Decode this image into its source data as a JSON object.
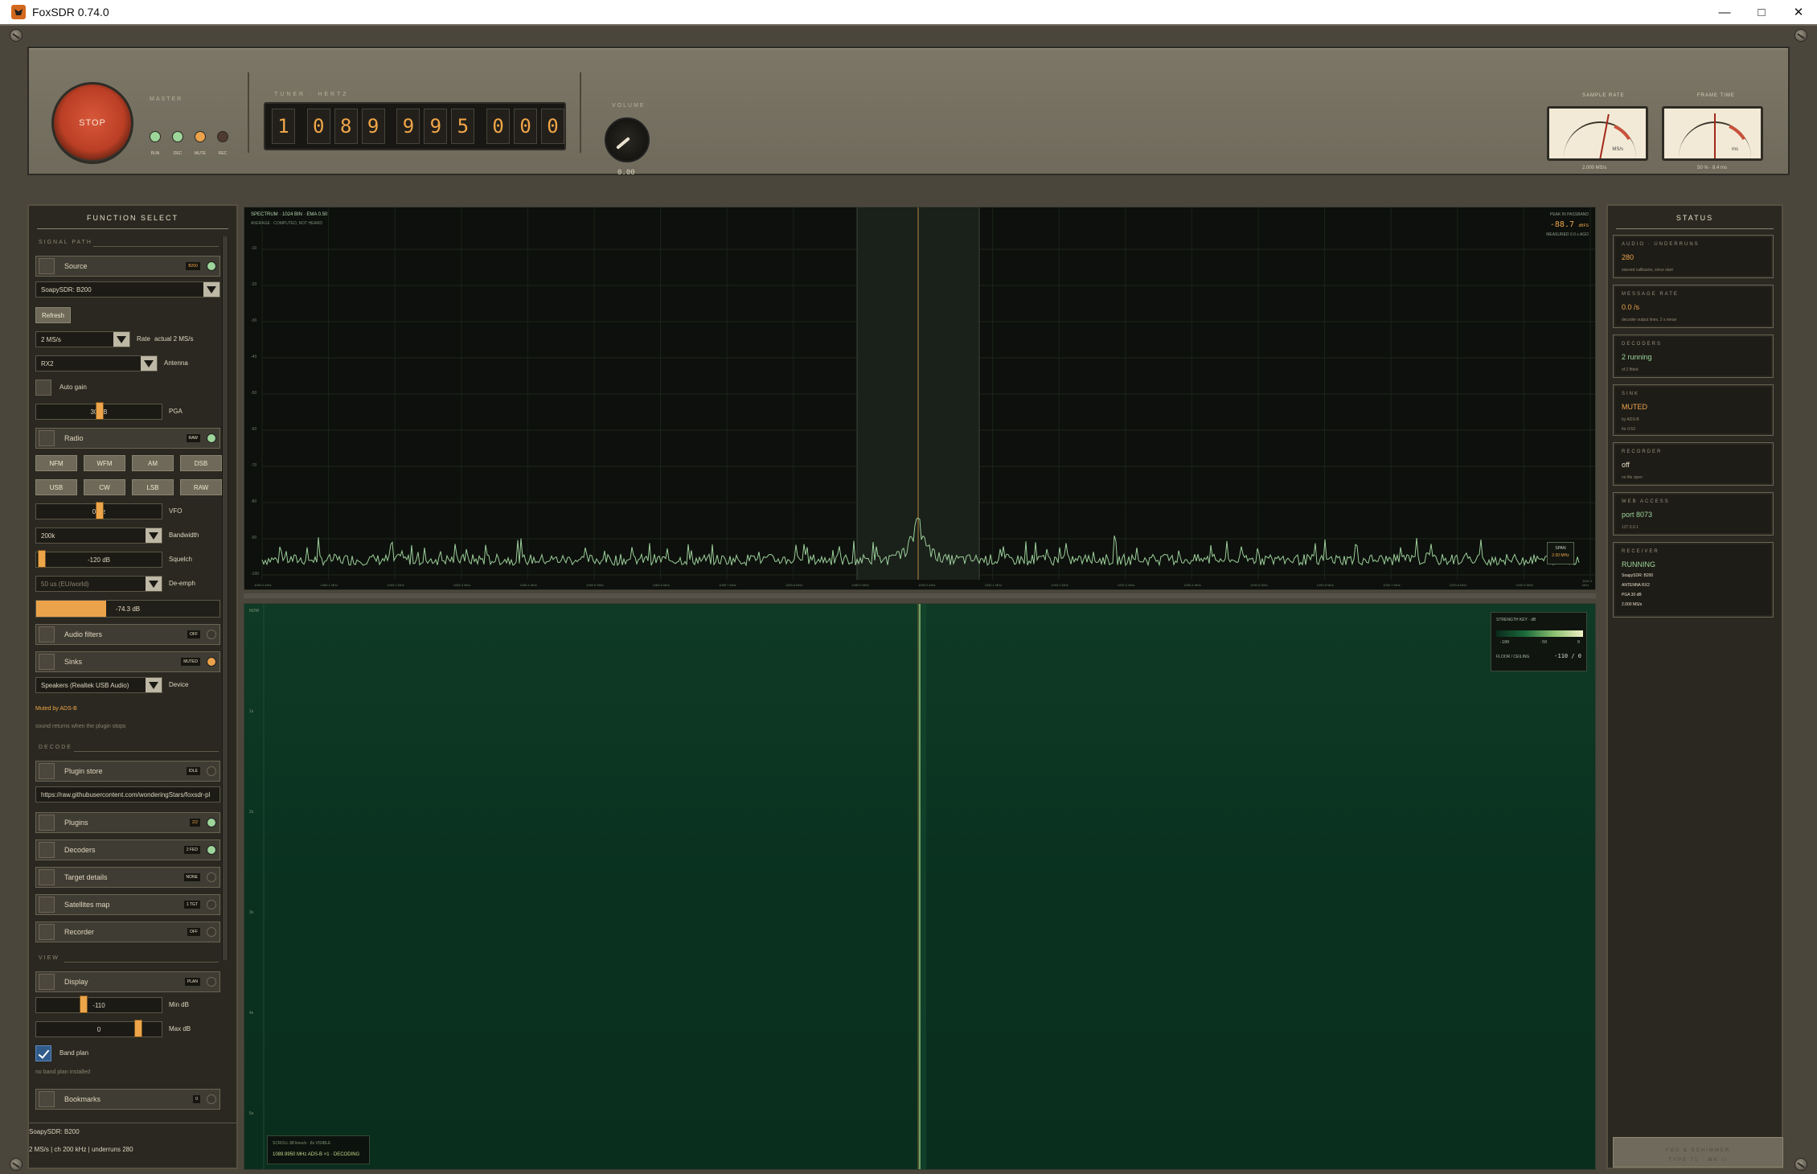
{
  "window": {
    "title": "FoxSDR 0.74.0"
  },
  "master": {
    "stop_label": "STOP",
    "section_label": "MASTER",
    "leds": [
      {
        "label": "RUN",
        "color": "#9dd59a"
      },
      {
        "label": "DEC",
        "color": "#9dd59a"
      },
      {
        "label": "MUTE",
        "color": "#eba24a"
      },
      {
        "label": "REC",
        "color": "#4e3a2f"
      }
    ]
  },
  "tuner": {
    "label": "TUNER · HERTZ",
    "digits": [
      "1",
      "0",
      "8",
      "9",
      "9",
      "9",
      "5",
      "0",
      "0",
      "0"
    ]
  },
  "knob": {
    "label": "VOLUME",
    "value": "0.00"
  },
  "meters": [
    {
      "label": "SAMPLE RATE",
      "unit": "MS/s",
      "value": "2.000 MS/s",
      "level": 0.62
    },
    {
      "label": "FRAME TIME",
      "unit": "ms",
      "value": "50 % · 8.4 ms",
      "level": 0.5
    }
  ],
  "function_select": {
    "title": "FUNCTION SELECT",
    "sections": {
      "signal": "SIGNAL PATH",
      "decode": "DECODE",
      "view": "VIEW"
    },
    "source": {
      "label": "Source",
      "badge": "B200",
      "device": "SoapySDR: B200",
      "refresh": "Refresh",
      "rate": "2 MS/s",
      "rate_label": "Rate",
      "rate_actual": "actual 2 MS/s",
      "antenna": "RX2",
      "antenna_label": "Antenna",
      "autogain": "Auto gain",
      "pga_value": "30 dB",
      "pga_label": "PGA"
    },
    "radio": {
      "label": "Radio",
      "badge": "RAW",
      "modes": [
        "NFM",
        "WFM",
        "AM",
        "DSB",
        "USB",
        "CW",
        "LSB",
        "RAW"
      ],
      "vfo_value": "0 Hz",
      "vfo_label": "VFO",
      "bandwidth": "200k",
      "bandwidth_label": "Bandwidth",
      "squelch_value": "-120 dB",
      "squelch_label": "Squelch",
      "deemph": "50 us (EU/world)",
      "deemph_label": "De-emph",
      "level_value": "-74.3 dB",
      "level_fraction": 0.38
    },
    "audio_filters": {
      "label": "Audio filters",
      "badge": "OFF"
    },
    "sinks": {
      "label": "Sinks",
      "badge": "MUTED",
      "device": "Speakers (Realtek USB Audio)",
      "device_label": "Device",
      "muted_by": "Muted by ADS-B",
      "note": "sound returns when the plugin stops"
    },
    "plugin_store": {
      "label": "Plugin store",
      "badge": "IDLE",
      "url": "https://raw.githubusercontent.com/wonderingStars/foxsdr-pl"
    },
    "plugins": {
      "label": "Plugins",
      "badge": "2/2"
    },
    "decoders": {
      "label": "Decoders",
      "badge": "2 FED"
    },
    "target_details": {
      "label": "Target details",
      "badge": "NONE"
    },
    "satellites_map": {
      "label": "Satellites map",
      "badge": "1 TGT"
    },
    "recorder": {
      "label": "Recorder",
      "badge": "OFF"
    },
    "display": {
      "label": "Display",
      "badge": "PLAN",
      "min_value": "-110",
      "min_label": "Min dB",
      "max_value": "0",
      "max_label": "Max dB",
      "bandplan": "Band plan",
      "bandplan_note": "no band plan installed"
    },
    "bookmarks": {
      "label": "Bookmarks",
      "badge": "0"
    },
    "footer1": "SoapySDR: B200",
    "footer2": "2 MS/s | ch 200 kHz | underruns 280"
  },
  "spectrum": {
    "title": "SPECTRUM · 1024 BIN · EMA 0.50",
    "subtitle": "AVERAGE · COMPUTED, NOT HEARD",
    "peak_label": "PEAK IN PASSBAND",
    "peak_value": "-88.7",
    "peak_unit": "dBFS",
    "measured": "MEASURED 0.0 s AGO",
    "y_ticks": [
      "-10",
      "-20",
      "-30",
      "-40",
      "-50",
      "-60",
      "-70",
      "-80",
      "-90",
      "-100"
    ],
    "x_ticks": [
      "1089.0 MHz",
      "1089.1 MHz",
      "1089.2 MHz",
      "1089.3 MHz",
      "1089.4 MHz",
      "1089.5 MHz",
      "1089.6 MHz",
      "1089.7 MHz",
      "1089.8 MHz",
      "1089.9 MHz",
      "1090.0 MHz",
      "1090.1 MHz",
      "1090.2 MHz",
      "1090.3 MHz",
      "1090.4 MHz",
      "1090.5 MHz",
      "1090.6 MHz",
      "1090.7 MHz",
      "1090.8 MHz",
      "1090.9 MHz",
      "1091.0 MHz"
    ],
    "span_label": "SPAN",
    "span_value": "2.00 MHz"
  },
  "waterfall": {
    "y_ticks": [
      "NOW",
      "1s",
      "2s",
      "3s",
      "4s",
      "5s"
    ],
    "legend_title": "STRENGTH KEY · dB",
    "legend_ticks": [
      "-100",
      "-50",
      "0"
    ],
    "floor_label": "FLOOR / CEILING",
    "floor_value": "-110 / 0",
    "scroll_text": "SCROLL 88 lines/s · 8s VISIBLE",
    "decoding_text": "1089.9950 MHz ADS-B ×1 · DECODING"
  },
  "status": {
    "title": "STATUS",
    "cards": [
      {
        "label": "AUDIO · UNDERRUNS",
        "value": "280",
        "note": "starved callbacks, since start",
        "color": "#eda54a"
      },
      {
        "label": "MESSAGE RATE",
        "value": "0.0 /s",
        "note": "decoder output lines, 2 s mean",
        "color": "#eda54a"
      },
      {
        "label": "DECODERS",
        "value": "2 running",
        "note": "of 2 fitted",
        "color": "#9dd69a"
      },
      {
        "label": "SINK",
        "value": "MUTED",
        "note": "by ADS-B",
        "note2": "for 0:53",
        "color": "#eda54a"
      },
      {
        "label": "RECORDER",
        "value": "off",
        "note": "no file open",
        "color": "#e8dfc8"
      },
      {
        "label": "WEB ACCESS",
        "value": "port 8073",
        "note": "127.0.0.1",
        "color": "#9dd69a"
      },
      {
        "label": "RECEIVER",
        "value": "RUNNING",
        "note": "SoapySDR: B200",
        "lines": [
          "SoapySDR: B200",
          "ANTENNA RX2",
          "PGA 30 dB",
          "2.000 MS/s"
        ],
        "color": "#9dd69a"
      }
    ],
    "footer1": "FOX & SCHIMMER",
    "footer2": "TYPE 71 · MK II"
  }
}
